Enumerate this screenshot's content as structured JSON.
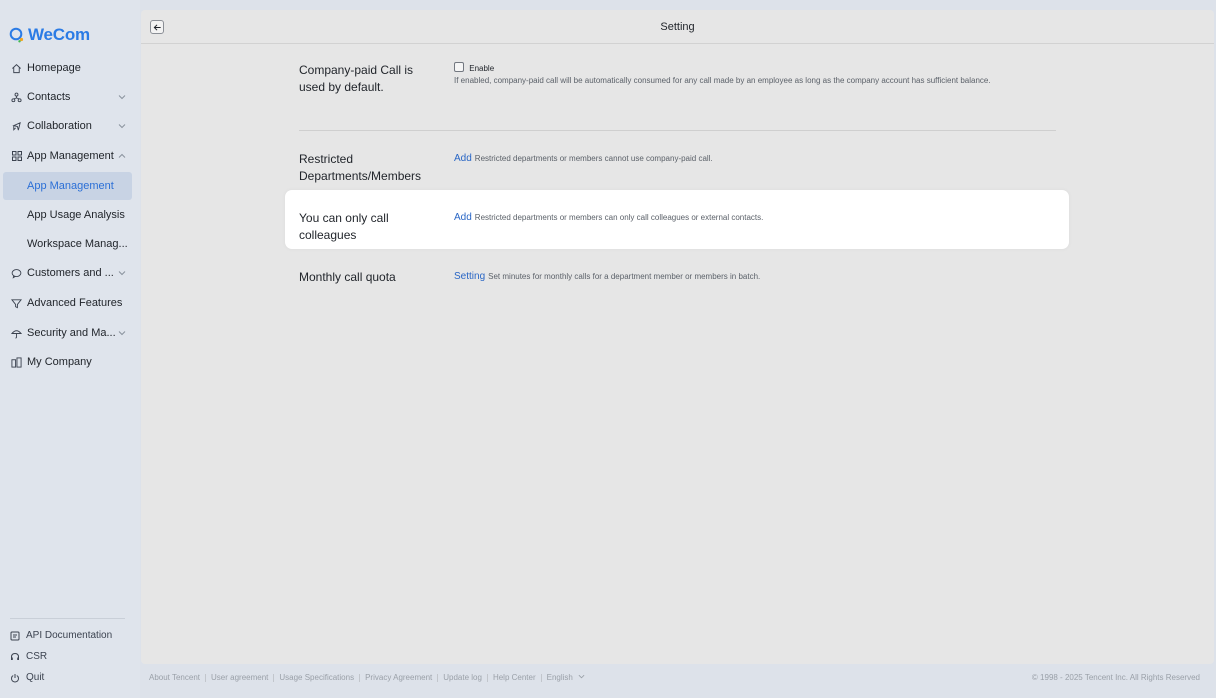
{
  "app": {
    "logo_text": "WeCom"
  },
  "sidebar": {
    "items": [
      {
        "label": "Homepage"
      },
      {
        "label": "Contacts"
      },
      {
        "label": "Collaboration"
      },
      {
        "label": "App Management"
      },
      {
        "label": "App Management"
      },
      {
        "label": "App Usage Analysis"
      },
      {
        "label": "Workspace Manag..."
      },
      {
        "label": "Customers and ..."
      },
      {
        "label": "Advanced Features"
      },
      {
        "label": "Security and Ma..."
      },
      {
        "label": "My Company"
      }
    ],
    "bottom": [
      {
        "label": "API Documentation"
      },
      {
        "label": "CSR"
      },
      {
        "label": "Quit"
      }
    ]
  },
  "page": {
    "title": "Setting",
    "rows": [
      {
        "label": "Company-paid Call is used by default.",
        "checkbox_label": "Enable",
        "description": "If enabled, company-paid call will be automatically consumed for any call made by an employee as long as the company account has sufficient balance."
      },
      {
        "label": "Restricted Departments/Members",
        "link": "Add",
        "description": "Restricted departments or members cannot use company-paid call."
      },
      {
        "label": "You can only call colleagues",
        "link": "Add",
        "description": "Restricted departments or members can only call colleagues or external contacts."
      },
      {
        "label": "Monthly call quota",
        "link": "Setting",
        "description": "Set minutes for monthly calls for a department member or members in batch."
      }
    ]
  },
  "footer": {
    "links": [
      "About Tencent",
      "User agreement",
      "Usage Specifications",
      "Privacy Agreement",
      "Update log",
      "Help Center",
      "English"
    ],
    "copyright": "© 1998 - 2025 Tencent Inc. All Rights Reserved"
  },
  "colors": {
    "accent": "#2b7be5",
    "link": "#2966c5",
    "active_bg": "#c8d3e4"
  }
}
